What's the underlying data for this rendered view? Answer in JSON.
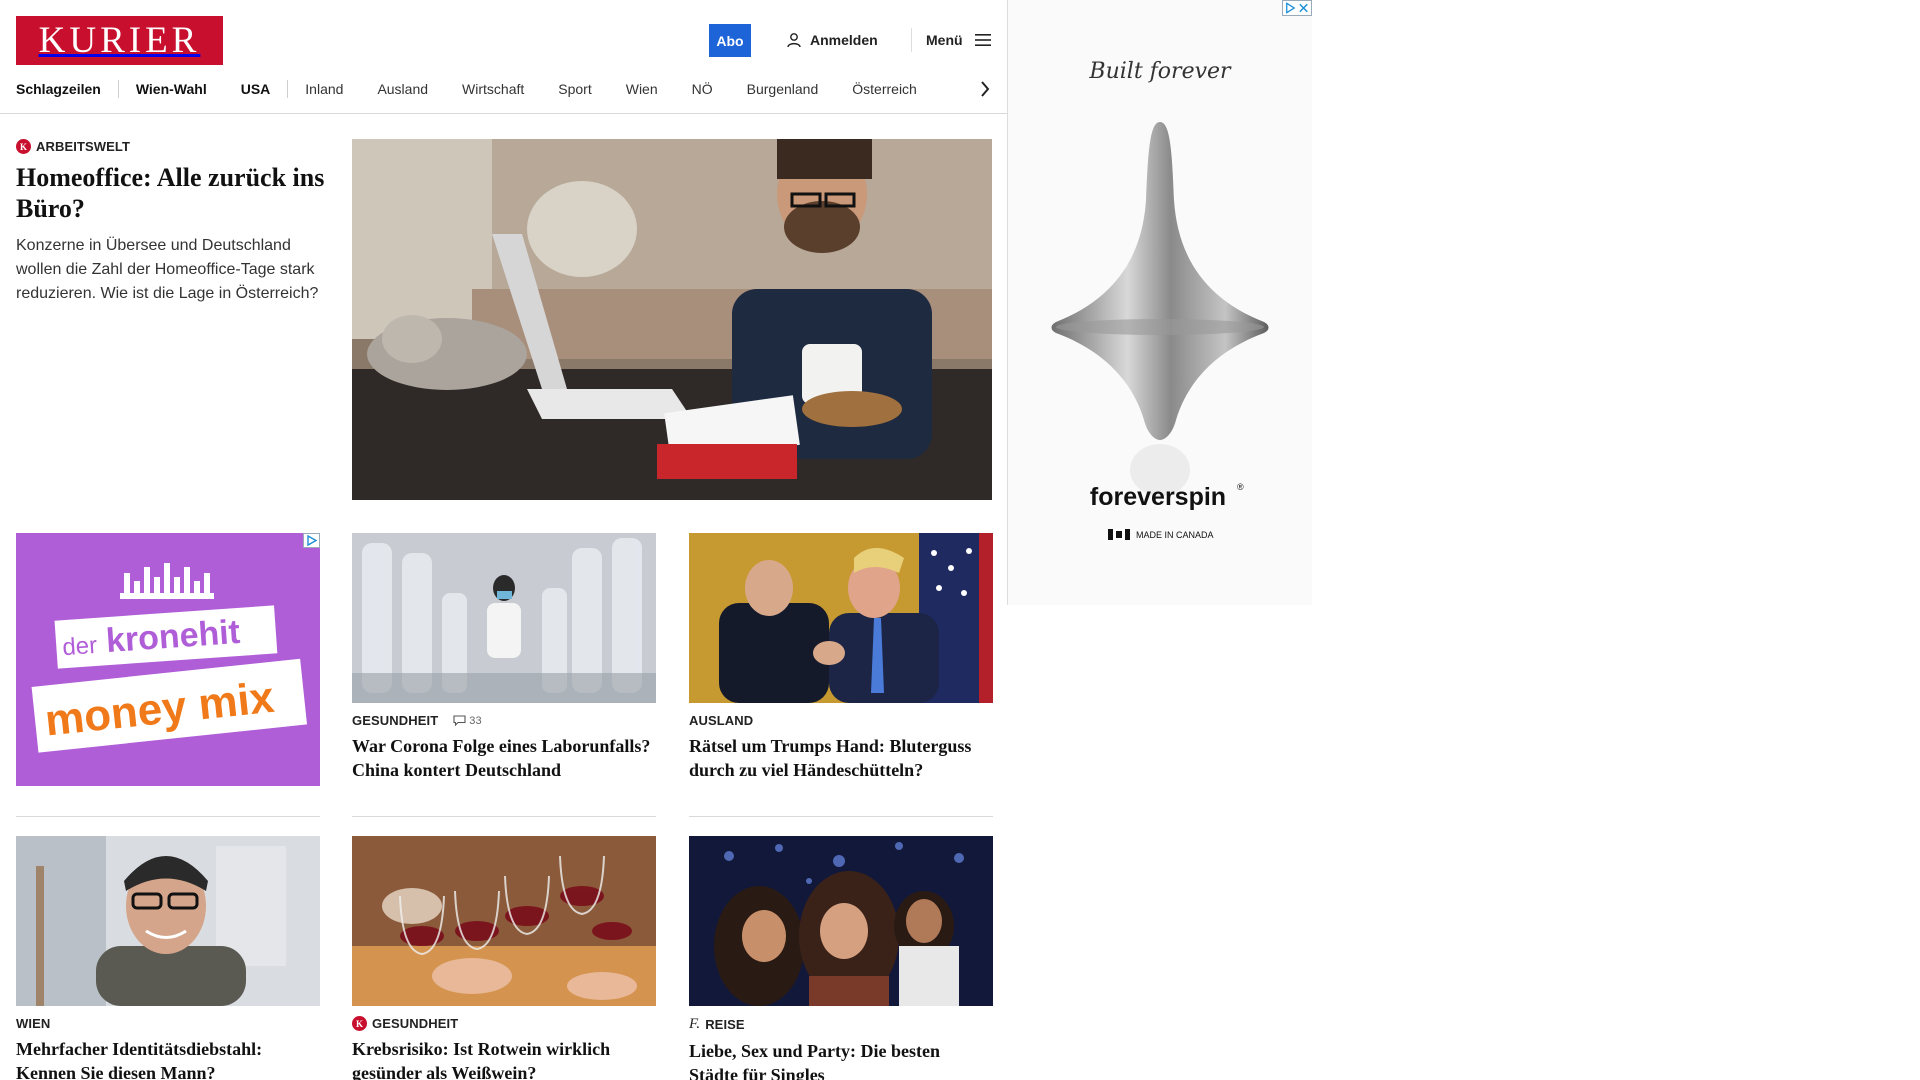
{
  "header": {
    "logo_text": "KURIER",
    "abo_label": "Abo",
    "login_label": "Anmelden",
    "menu_label": "Menü"
  },
  "nav": {
    "items": [
      "Schlagzeilen",
      "Wien-Wahl",
      "USA",
      "Inland",
      "Ausland",
      "Wirtschaft",
      "Sport",
      "Wien",
      "NÖ",
      "Burgenland",
      "Österreich"
    ]
  },
  "lead": {
    "kicker": "ARBEITSWELT",
    "title": "Homeoffice: Alle zurück ins Büro?",
    "teaser": "Konzerne in Übersee und Deutschland wollen die Zahl der Homeoffice-Tage stark reduzieren. Wie ist die Lage in Österreich?"
  },
  "ad_small": {
    "line1": "der",
    "line2": "kronehit",
    "line3": "money mix"
  },
  "cards": [
    {
      "kicker": "GESUNDHEIT",
      "comments": "33",
      "title": "War Corona Folge eines Laborunfalls? China kontert Deutschland"
    },
    {
      "kicker": "AUSLAND",
      "title": "Rätsel um Trumps Hand: Bluterguss durch zu viel Händeschütteln?"
    },
    {
      "kicker": "WIEN",
      "title": "Mehrfacher Identitätsdiebstahl: Kennen Sie diesen Mann?"
    },
    {
      "kicker": "GESUNDHEIT",
      "title": "Krebsrisiko: Ist Rotwein wirklich gesünder als Weißwein?"
    },
    {
      "kicker": "REISE",
      "title": "Liebe, Sex und Party: Die besten Städte für Singles"
    }
  ],
  "ad_right": {
    "tagline": "Built forever",
    "brand": "foreverspin",
    "made_in": "MADE IN CANADA"
  },
  "colors": {
    "brand_red": "#c8102e",
    "abo_blue": "#1d64d8",
    "ad_purple": "#b05ed8",
    "ad_orange": "#f07a1a"
  }
}
